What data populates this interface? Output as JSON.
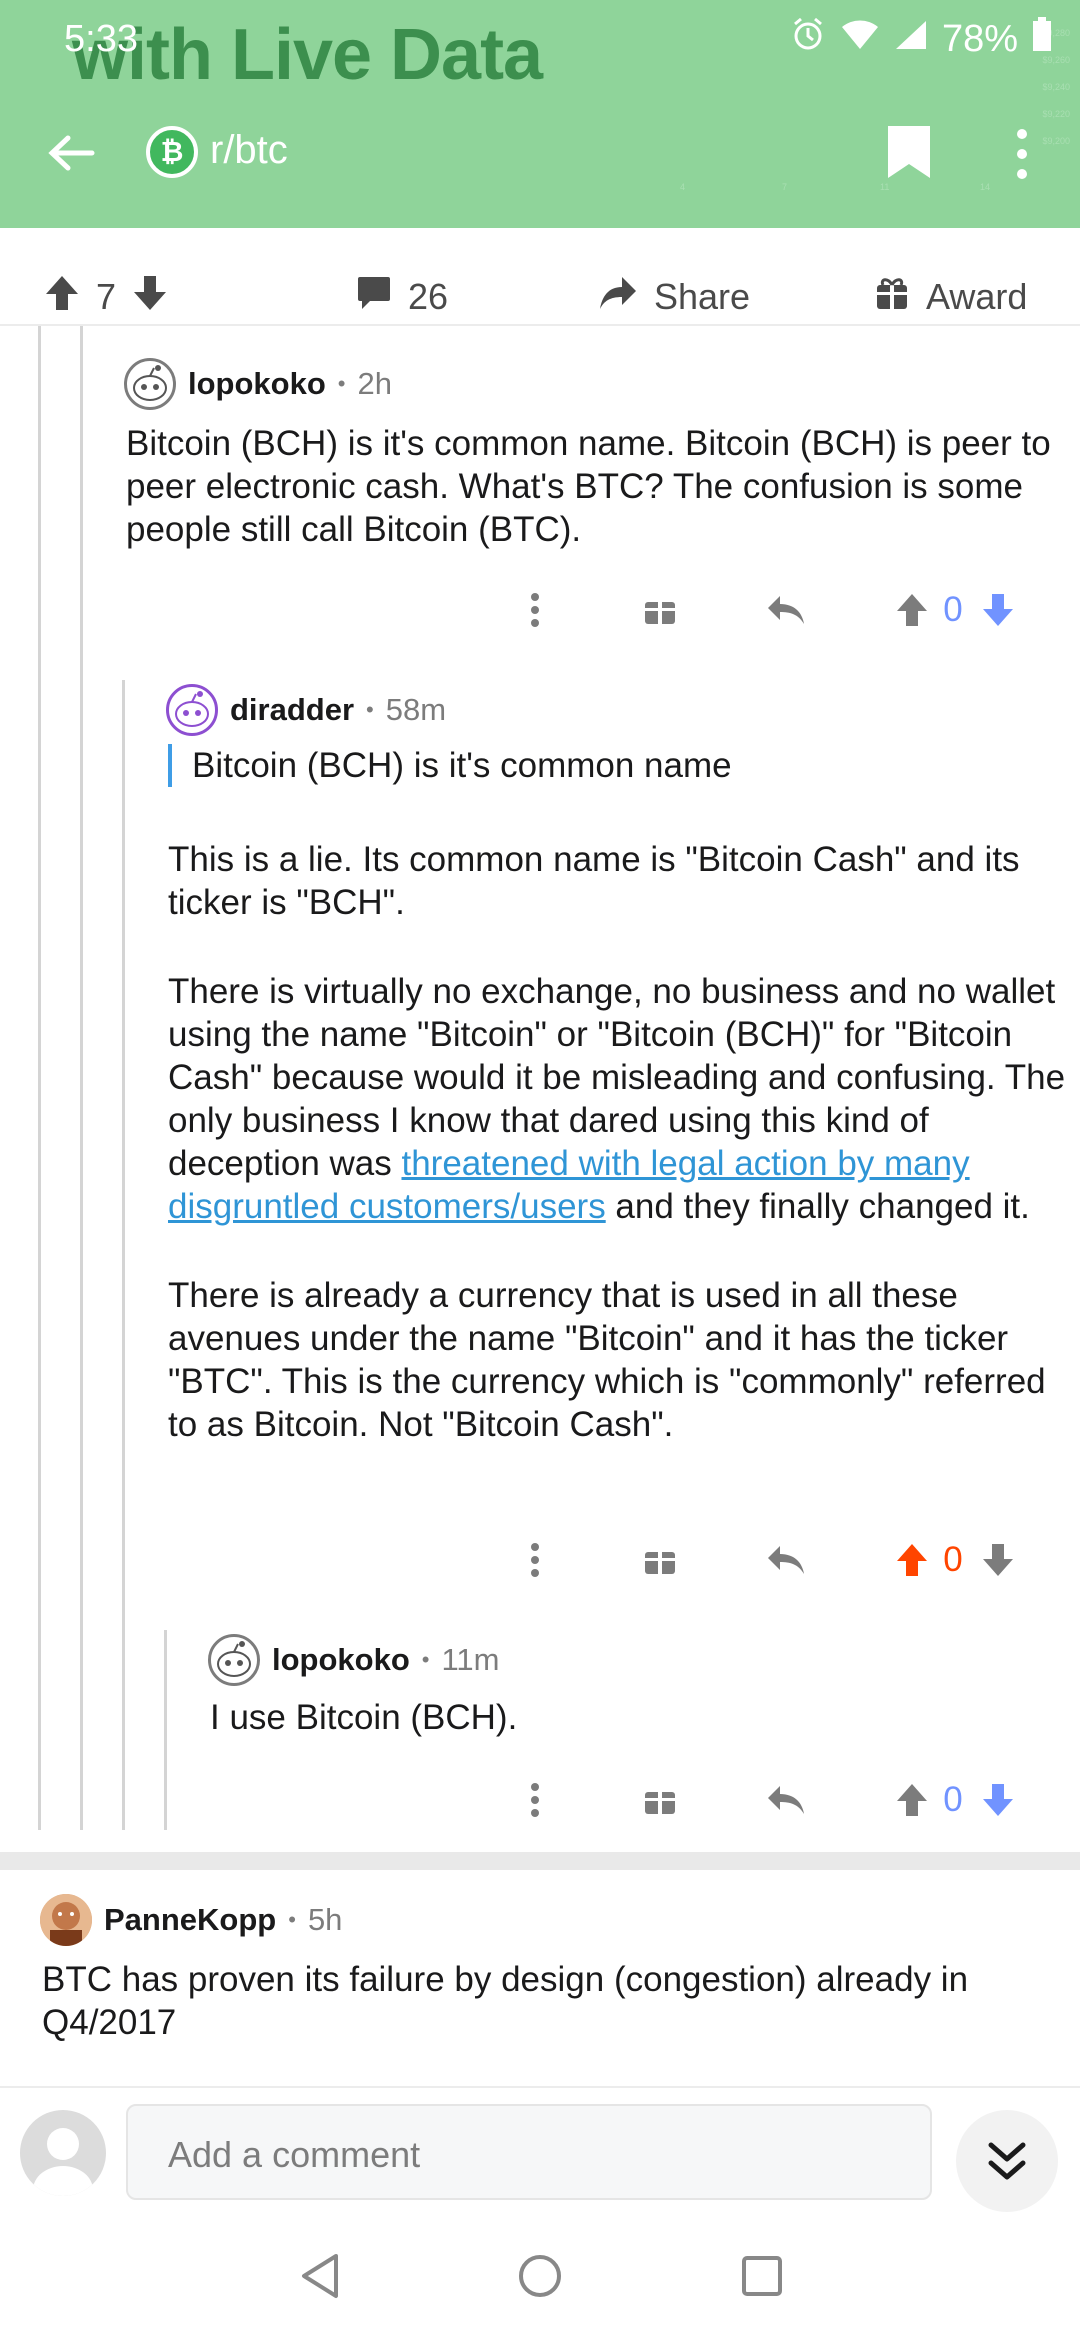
{
  "status_bar": {
    "time": "5:33",
    "battery": "78%"
  },
  "header": {
    "background_title": "with Live Data",
    "subreddit": "r/btc",
    "subreddit_icon_glyph": "₿",
    "bg_chart_y_ticks": [
      "$9,280",
      "$9,260",
      "$9,240",
      "$9,220",
      "$9,200"
    ],
    "bg_chart_x_ticks": [
      "4",
      "7",
      "11",
      "14"
    ]
  },
  "post_actions": {
    "upvotes": "7",
    "comments": "26",
    "share_label": "Share",
    "award_label": "Award"
  },
  "comments": [
    {
      "author": "lopokoko",
      "age": "2h",
      "paragraphs": [
        "Bitcoin (BCH) is it's common name. Bitcoin (BCH) is peer to peer electronic cash. What's BTC? The confusion is some people still call Bitcoin (BTC)."
      ],
      "score": "0",
      "vote_state": "downvoted"
    },
    {
      "author": "diradder",
      "age": "58m",
      "quote": "Bitcoin (BCH) is it's common name",
      "p1": "This is a lie. Its common name is \"Bitcoin Cash\" and its ticker is \"BCH\".",
      "p2_before": "There is virtually no exchange, no business and no wallet using the name \"Bitcoin\" or \"Bitcoin (BCH)\" for \"Bitcoin Cash\" because would it be misleading and confusing. The only business I know that dared using this kind of deception was ",
      "p2_link": "threatened with legal action by many disgruntled customers/users",
      "p2_after": " and they finally changed it.",
      "p3": "There is already a currency that is used in all these avenues under the name \"Bitcoin\" and it has the ticker \"BTC\". This is the currency which is \"commonly\" referred to as Bitcoin. Not \"Bitcoin Cash\".",
      "score": "0",
      "vote_state": "upvoted"
    },
    {
      "author": "lopokoko",
      "age": "11m",
      "paragraphs": [
        "I use Bitcoin (BCH)."
      ],
      "score": "0",
      "vote_state": "downvoted"
    },
    {
      "author": "PanneKopp",
      "age": "5h",
      "paragraphs": [
        "BTC has proven its failure by design (congestion) already in Q4/2017"
      ]
    }
  ],
  "composer": {
    "placeholder": "Add a comment"
  },
  "colors": {
    "header_green": "#8fd49a",
    "upvote_orange": "#ff4500",
    "downvote_blue": "#7193ff",
    "link_blue": "#2f95d6"
  }
}
